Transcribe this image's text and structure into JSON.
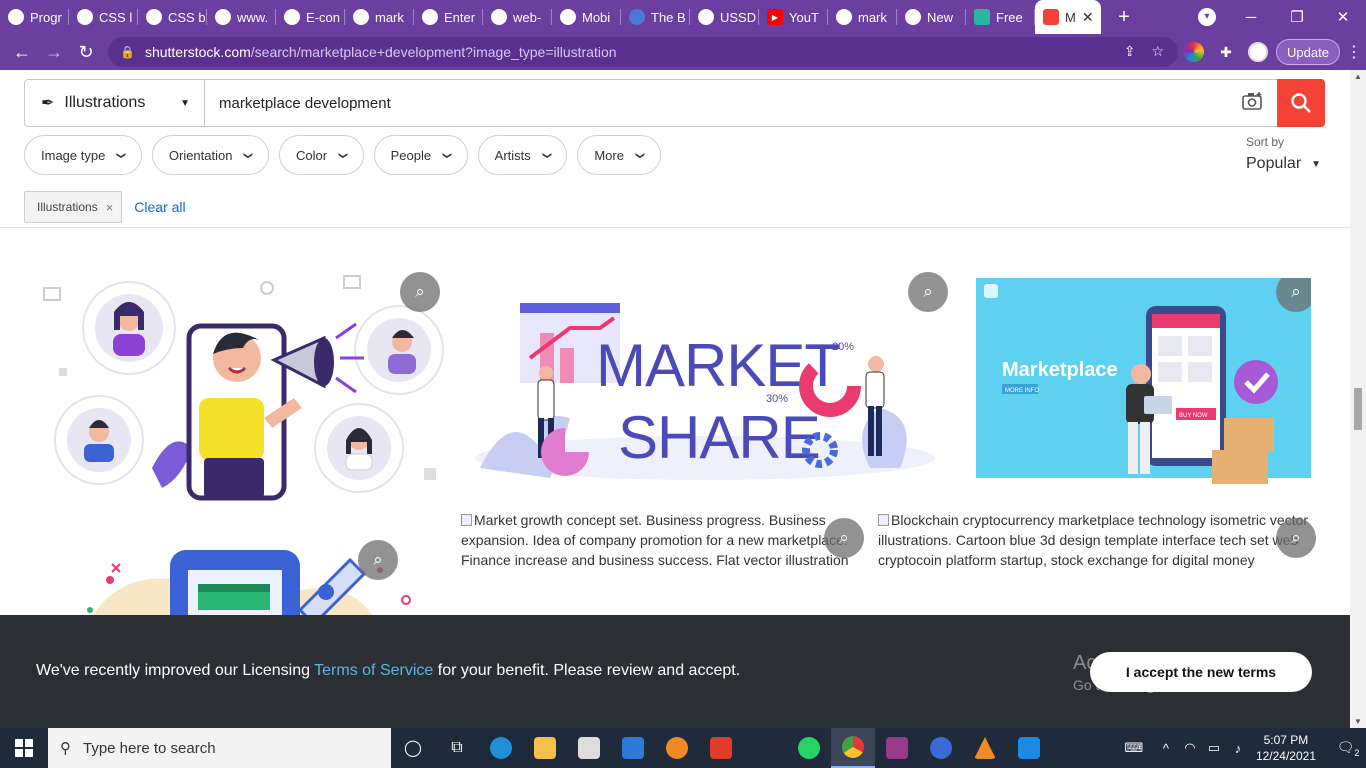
{
  "browser": {
    "tabs": [
      {
        "label": "Progr",
        "icon": "chrome-icon"
      },
      {
        "label": "CSS l",
        "icon": "chrome-icon"
      },
      {
        "label": "CSS b",
        "icon": "chrome-icon"
      },
      {
        "label": "www.",
        "icon": "globe-icon"
      },
      {
        "label": "E-con",
        "icon": "chrome-icon"
      },
      {
        "label": "mark",
        "icon": "chrome-icon"
      },
      {
        "label": "Enter",
        "icon": "chrome-icon"
      },
      {
        "label": "web-",
        "icon": "chrome-icon"
      },
      {
        "label": "Mobi",
        "icon": "chrome-icon"
      },
      {
        "label": "The B",
        "icon": "stripe-icon"
      },
      {
        "label": "USSD",
        "icon": "chrome-icon"
      },
      {
        "label": "YouT",
        "icon": "youtube-icon"
      },
      {
        "label": "mark",
        "icon": "chrome-icon"
      },
      {
        "label": "New",
        "icon": "chrome-icon"
      },
      {
        "label": "Free",
        "icon": "d-icon"
      },
      {
        "label": "M",
        "icon": "shutterstock-icon",
        "active": true
      }
    ],
    "new_tab": "+",
    "url_host": "shutterstock.com",
    "url_path": "/search/marketplace+development?image_type=illustration",
    "update_label": "Update"
  },
  "search": {
    "type_label": "Illustrations",
    "query": "marketplace development"
  },
  "filters": [
    "Image type",
    "Orientation",
    "Color",
    "People",
    "Artists",
    "More"
  ],
  "sort": {
    "label": "Sort by",
    "value": "Popular"
  },
  "active_filters": {
    "chip": "Illustrations",
    "clear": "Clear all"
  },
  "results": {
    "img2_words": [
      "MARKET",
      "SHARE"
    ],
    "img2_pcts": [
      "20%",
      "30%"
    ],
    "img3_title": "Marketplace",
    "img3_more": "MORE INFO",
    "img3_buy": "BUY NOW",
    "alt_texts": [
      "Market growth concept set. Business progress. Business expansion. Idea of company promotion for a new marketplace. Finance increase and business success. Flat vector illustration",
      "Blockchain cryptocurrency marketplace technology isometric vector illustrations. Cartoon blue 3d design template interface tech set web cryptocoin platform startup, stock exchange for digital money"
    ]
  },
  "banner": {
    "pre": "We've recently improved our Licensing ",
    "link": "Terms of Service",
    "post": " for your benefit. Please review and accept.",
    "button": "I accept the new terms"
  },
  "watermark": {
    "line1": "Activate Windows",
    "line2": "Go to Settings to activate Windows."
  },
  "taskbar": {
    "search_placeholder": "Type here to search",
    "time": "5:07 PM",
    "date": "12/24/2021",
    "notifications": "2"
  },
  "colors": {
    "browser_purple": "#6a3fa0",
    "search_red": "#f44336",
    "link_blue": "#0c6ecf",
    "banner_bg": "#2b2f33"
  }
}
